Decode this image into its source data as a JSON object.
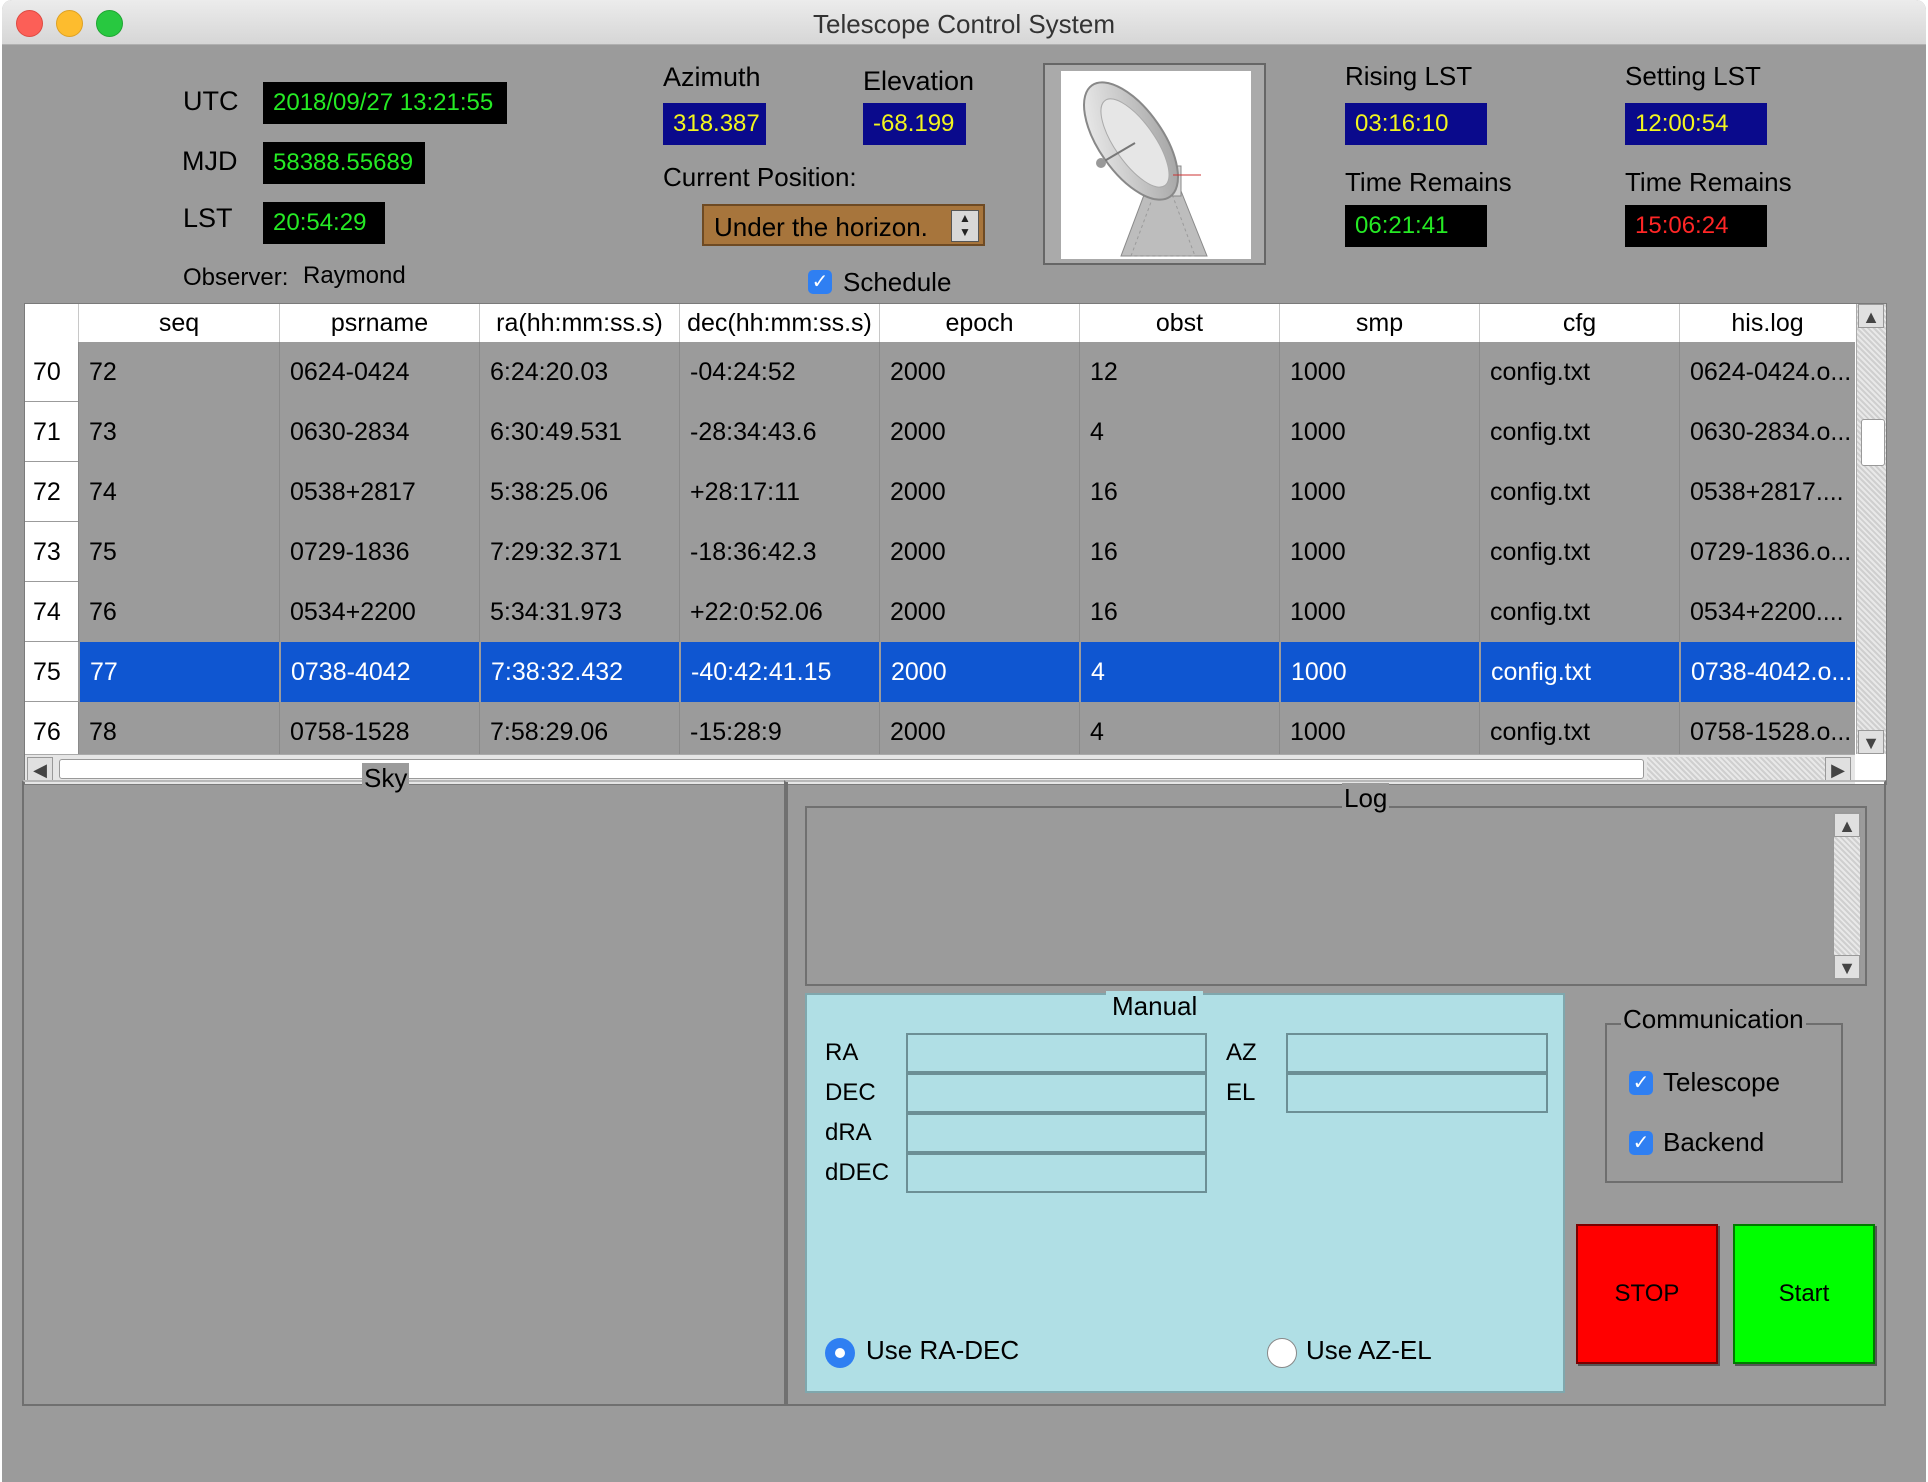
{
  "window": {
    "title": "Telescope Control System"
  },
  "clock": {
    "utc_label": "UTC",
    "utc_value": "2018/09/27 13:21:55",
    "mjd_label": "MJD",
    "mjd_value": "58388.55689",
    "lst_label": "LST",
    "lst_value": "20:54:29",
    "observer_label": "Observer:",
    "observer_value": "Raymond"
  },
  "position": {
    "azimuth_label": "Azimuth",
    "azimuth_value": "318.387",
    "elevation_label": "Elevation",
    "elevation_value": "-68.199",
    "current_label": "Current Position:",
    "current_value": "Under the horizon.",
    "schedule_label": "Schedule",
    "schedule_checked": true
  },
  "timing": {
    "rising_label": "Rising LST",
    "rising_value": "03:16:10",
    "setting_label": "Setting LST",
    "setting_value": "12:00:54",
    "remain1_label": "Time Remains",
    "remain1_value": "06:21:41",
    "remain2_label": "Time Remains",
    "remain2_value": "15:06:24"
  },
  "table": {
    "columns": [
      "seq",
      "psrname",
      "ra(hh:mm:ss.s)",
      "dec(hh:mm:ss.s)",
      "epoch",
      "obst",
      "smp",
      "cfg",
      "his.log"
    ],
    "rows": [
      {
        "num": "70",
        "cells": [
          "72",
          "0624-0424",
          "6:24:20.03",
          "-04:24:52",
          "2000",
          "12",
          "1000",
          "config.txt",
          "0624-0424.o..."
        ],
        "selected": false
      },
      {
        "num": "71",
        "cells": [
          "73",
          "0630-2834",
          "6:30:49.531",
          "-28:34:43.6",
          "2000",
          "4",
          "1000",
          "config.txt",
          "0630-2834.o..."
        ],
        "selected": false
      },
      {
        "num": "72",
        "cells": [
          "74",
          "0538+2817",
          "5:38:25.06",
          "+28:17:11",
          "2000",
          "16",
          "1000",
          "config.txt",
          "0538+2817...."
        ],
        "selected": false
      },
      {
        "num": "73",
        "cells": [
          "75",
          "0729-1836",
          "7:29:32.371",
          "-18:36:42.3",
          "2000",
          "16",
          "1000",
          "config.txt",
          "0729-1836.o..."
        ],
        "selected": false
      },
      {
        "num": "74",
        "cells": [
          "76",
          "0534+2200",
          "5:34:31.973",
          "+22:0:52.06",
          "2000",
          "16",
          "1000",
          "config.txt",
          "0534+2200...."
        ],
        "selected": false
      },
      {
        "num": "75",
        "cells": [
          "77",
          "0738-4042",
          "7:38:32.432",
          "-40:42:41.15",
          "2000",
          "4",
          "1000",
          "config.txt",
          "0738-4042.o..."
        ],
        "selected": true
      },
      {
        "num": "76",
        "cells": [
          "78",
          "0758-1528",
          "7:58:29.06",
          "-15:28:9",
          "2000",
          "4",
          "1000",
          "config.txt",
          "0758-1528.o..."
        ],
        "selected": false
      }
    ]
  },
  "panels": {
    "sky_title": "Sky",
    "log_title": "Log"
  },
  "manual": {
    "title": "Manual",
    "ra_label": "RA",
    "dec_label": "DEC",
    "dra_label": "dRA",
    "ddec_label": "dDEC",
    "az_label": "AZ",
    "el_label": "EL",
    "ra_value": "",
    "dec_value": "",
    "dra_value": "",
    "ddec_value": "",
    "az_value": "",
    "el_value": "",
    "use_radec_label": "Use RA-DEC",
    "use_azel_label": "Use AZ-EL",
    "selected_mode": "Use RA-DEC"
  },
  "communication": {
    "title": "Communication",
    "telescope_label": "Telescope",
    "telescope_checked": true,
    "backend_label": "Backend",
    "backend_checked": true
  },
  "buttons": {
    "stop_label": "STOP",
    "start_label": "Start"
  },
  "colors": {
    "window_bg": "#9b9b9b",
    "led_green": "#25ea24",
    "led_yellow": "#f2f51e",
    "led_red": "#ff2626",
    "selection": "#0f56d1",
    "manual_bg": "#b0dfe5",
    "stop_bg": "#ff0000",
    "start_bg": "#00ff00"
  }
}
